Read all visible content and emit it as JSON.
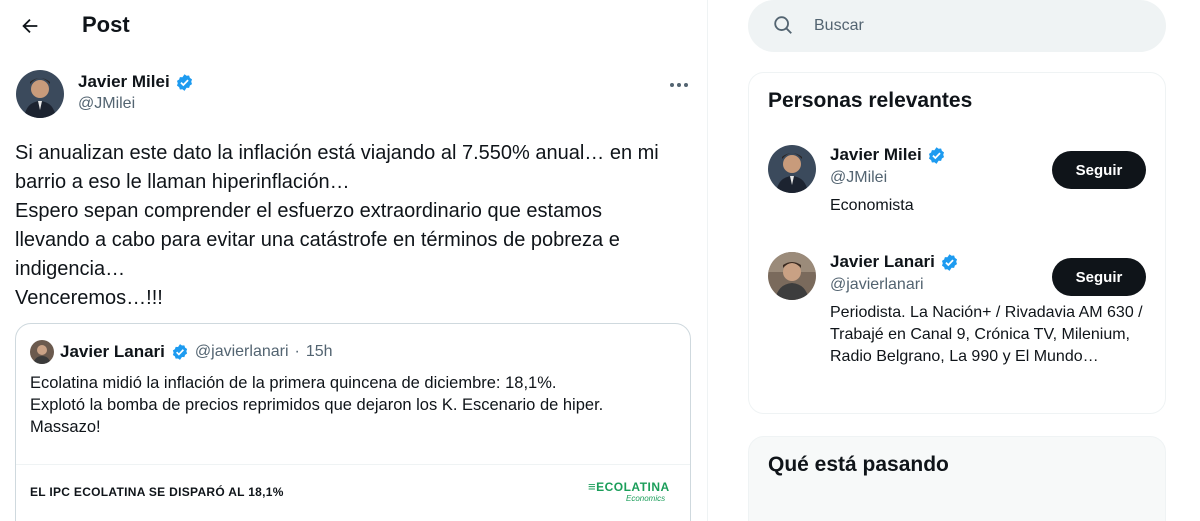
{
  "header": {
    "title": "Post",
    "back_icon": "arrow-left-icon"
  },
  "post": {
    "author_name": "Javier Milei",
    "author_handle": "@JMilei",
    "more_icon": "more-horizontal-icon",
    "lines": [
      "Si anualizan este dato la inflación está viajando al 7.550% anual… en mi",
      "barrio a eso le llaman hiperinflación…",
      "Espero sepan comprender el esfuerzo extraordinario que estamos",
      "llevando a cabo para evitar una catástrofe en términos de pobreza e",
      "indigencia…",
      "Venceremos…!!!"
    ]
  },
  "quote": {
    "author_name": "Javier Lanari",
    "author_handle": "@javierlanari",
    "separator": "·",
    "time": "15h",
    "lines": [
      "Ecolatina midió la inflación de la primera quincena de diciembre: 18,1%.",
      "Explotó la bomba de precios reprimidos que dejaron los K. Escenario de hiper.",
      "Massazo!"
    ],
    "image_caption": "EL IPC ECOLATINA SE DISPARÓ AL 18,1%",
    "brand_name": "ECOLATINA",
    "brand_sub": "Economics"
  },
  "search": {
    "placeholder": "Buscar"
  },
  "relevant": {
    "title": "Personas relevantes",
    "people": [
      {
        "name": "Javier Milei",
        "handle": "@JMilei",
        "bio": "Economista",
        "button": "Seguir"
      },
      {
        "name": "Javier Lanari",
        "handle": "@javierlanari",
        "bio": "Periodista. La Nación+ / Rivadavia AM 630 / Trabajé en Canal 9, Crónica TV, Milenium, Radio Belgrano, La 990 y El Mundo…",
        "button": "Seguir"
      }
    ]
  },
  "trends": {
    "title": "Qué está pasando"
  },
  "colors": {
    "verified": "#1d9bf0",
    "text": "#0f1419",
    "muted": "#536471",
    "button": "#0f1419"
  }
}
